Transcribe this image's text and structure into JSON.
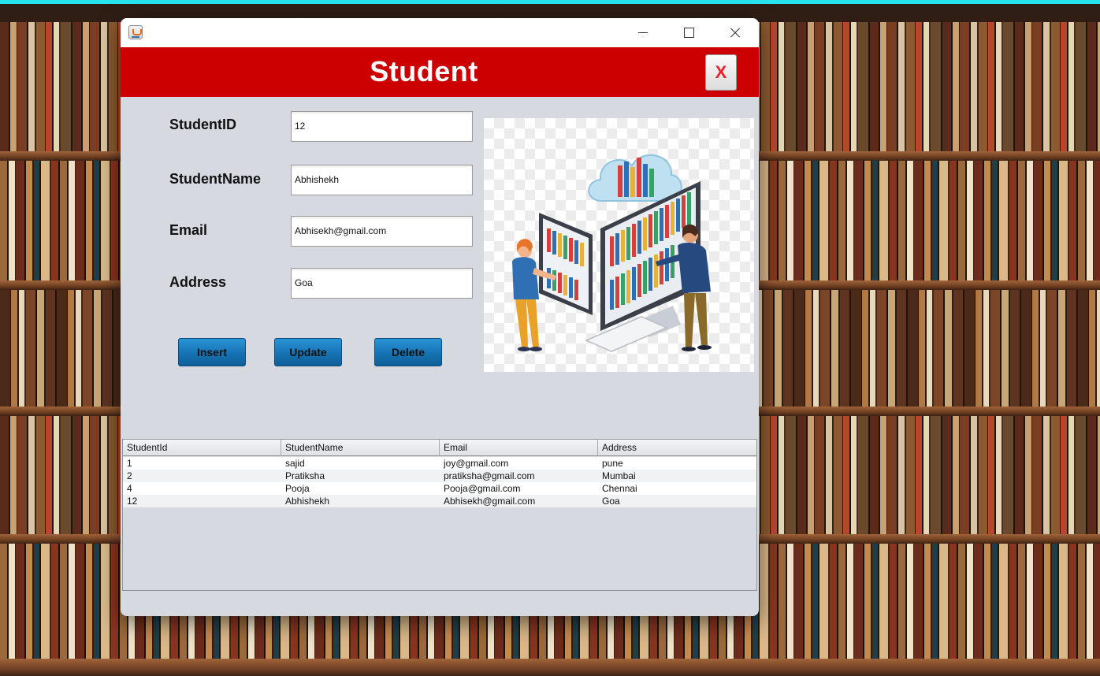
{
  "window": {
    "title_icon": "java-cup-icon",
    "header_title": "Student",
    "close_label": "X"
  },
  "form": {
    "fields": [
      {
        "label": "StudentID",
        "value": "12"
      },
      {
        "label": "StudentName",
        "value": "Abhishekh"
      },
      {
        "label": "Email",
        "value": "Abhisekh@gmail.com"
      },
      {
        "label": "Address",
        "value": "Goa"
      }
    ],
    "buttons": {
      "insert": "Insert",
      "update": "Update",
      "delete": "Delete"
    }
  },
  "table": {
    "columns": [
      "StudentId",
      "StudentName",
      "Email",
      "Address"
    ],
    "rows": [
      [
        "1",
        "sajid",
        "joy@gmail.com",
        "pune"
      ],
      [
        "2",
        "Pratiksha",
        "pratiksha@gmail.com",
        "Mumbai"
      ],
      [
        "4",
        "Pooja",
        "Pooja@gmail.com",
        "Chennai"
      ],
      [
        "12",
        "Abhishekh",
        "Abhisekh@gmail.com",
        "Goa"
      ]
    ]
  },
  "colors": {
    "header_band": "#cc0000",
    "button_blue": "#1673b3",
    "close_x": "#e8242a",
    "panel_bg": "#d6d9e0"
  }
}
